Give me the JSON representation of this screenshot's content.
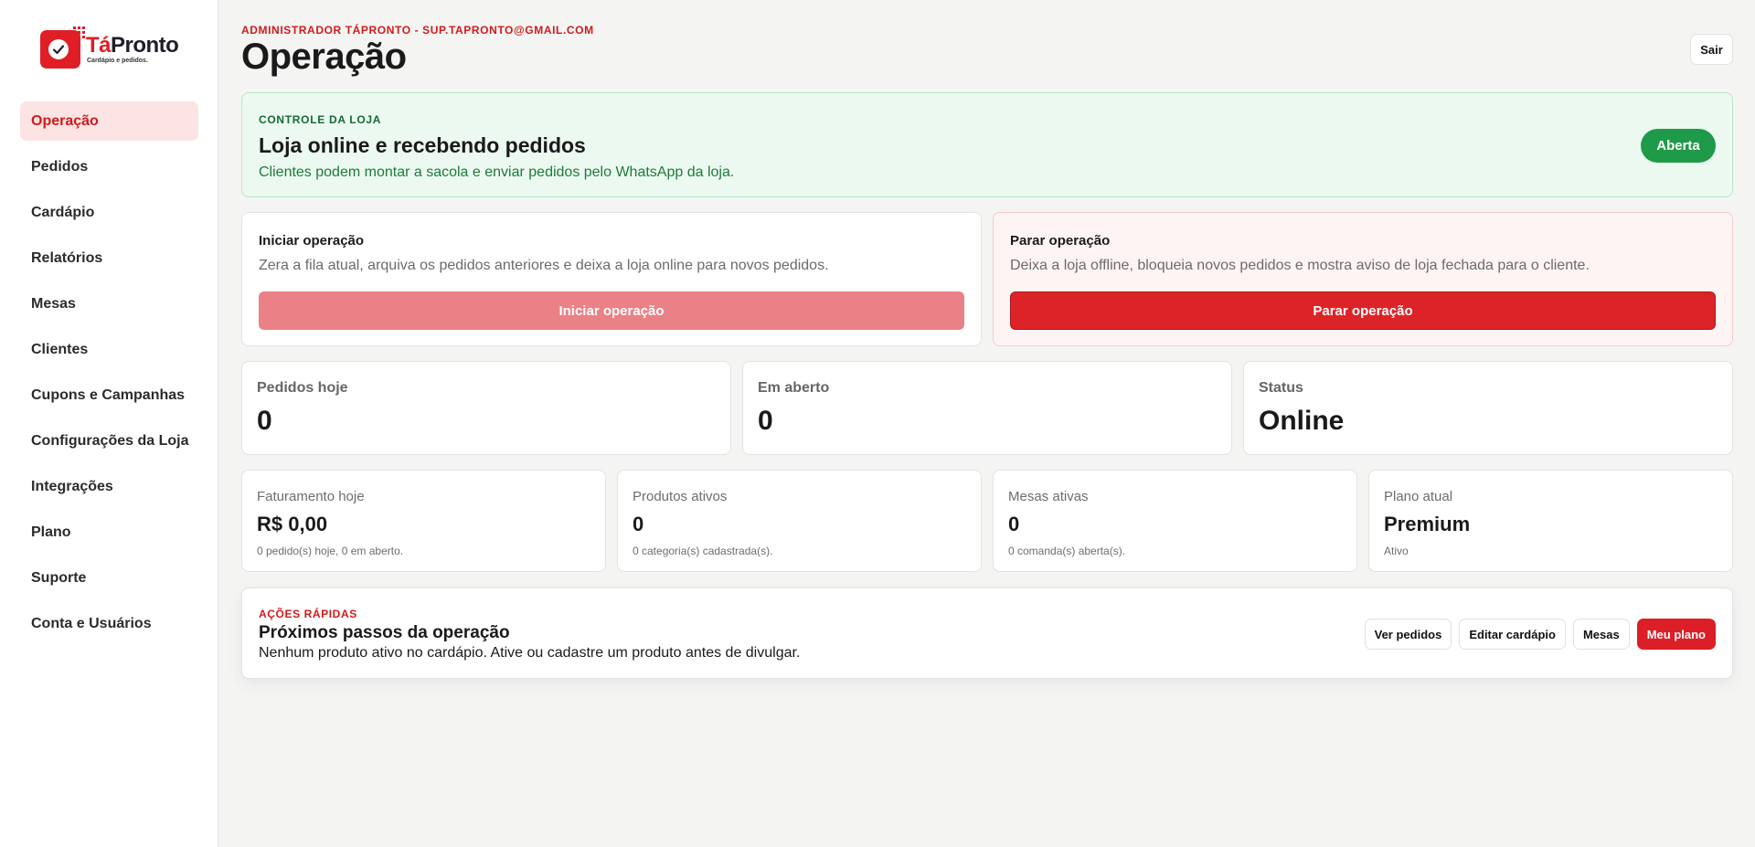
{
  "brand": {
    "name_part1": "Tá",
    "name_part2": "Pronto",
    "tagline": "Cardápio e pedidos.",
    "accent": "#e01e26"
  },
  "sidebar": {
    "items": [
      {
        "label": "Operação",
        "active": true
      },
      {
        "label": "Pedidos"
      },
      {
        "label": "Cardápio"
      },
      {
        "label": "Relatórios"
      },
      {
        "label": "Mesas"
      },
      {
        "label": "Clientes"
      },
      {
        "label": "Cupons e Campanhas"
      },
      {
        "label": "Configurações da Loja"
      },
      {
        "label": "Integrações"
      },
      {
        "label": "Plano"
      },
      {
        "label": "Suporte"
      },
      {
        "label": "Conta e Usuários"
      }
    ]
  },
  "header": {
    "admin_line": "ADMINISTRADOR TÁPRONTO - SUP.TAPRONTO@GMAIL.COM",
    "title": "Operação",
    "logout_label": "Sair"
  },
  "store_control": {
    "label": "CONTROLE DA LOJA",
    "title": "Loja online e recebendo pedidos",
    "description": "Clientes podem montar a sacola e enviar pedidos pelo WhatsApp da loja.",
    "status_badge": "Aberta",
    "status_color": "#1e9a48"
  },
  "start_operation": {
    "title": "Iniciar operação",
    "description": "Zera a fila atual, arquiva os pedidos anteriores e deixa a loja online para novos pedidos.",
    "button_label": "Iniciar operação"
  },
  "stop_operation": {
    "title": "Parar operação",
    "description": "Deixa a loja offline, bloqueia novos pedidos e mostra aviso de loja fechada para o cliente.",
    "button_label": "Parar operação"
  },
  "stats": [
    {
      "label": "Pedidos hoje",
      "value": "0"
    },
    {
      "label": "Em aberto",
      "value": "0"
    },
    {
      "label": "Status",
      "value": "Online"
    }
  ],
  "metrics": [
    {
      "label": "Faturamento hoje",
      "value": "R$ 0,00",
      "note": "0 pedido(s) hoje, 0 em aberto."
    },
    {
      "label": "Produtos ativos",
      "value": "0",
      "note": "0 categoria(s) cadastrada(s)."
    },
    {
      "label": "Mesas ativas",
      "value": "0",
      "note": "0 comanda(s) aberta(s)."
    },
    {
      "label": "Plano atual",
      "value": "Premium",
      "note": "Ativo"
    }
  ],
  "quick_actions": {
    "label": "AÇÕES RÁPIDAS",
    "title": "Próximos passos da operação",
    "description": "Nenhum produto ativo no cardápio. Ative ou cadastre um produto antes de divulgar.",
    "buttons": [
      "Ver pedidos",
      "Editar cardápio",
      "Mesas",
      "Meu plano"
    ]
  }
}
